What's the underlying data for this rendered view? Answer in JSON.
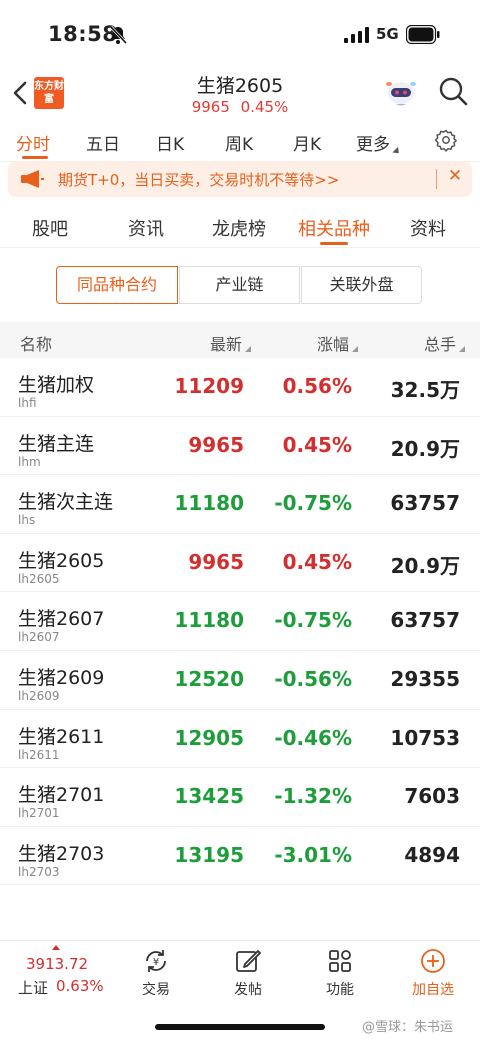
{
  "status": {
    "time": "18:58",
    "network": "5G"
  },
  "header": {
    "logo_text": "东方财富",
    "title": "生猪2605",
    "price": "9965",
    "change_pct": "0.45%"
  },
  "period_tabs": [
    {
      "label": "分时",
      "active": true
    },
    {
      "label": "五日"
    },
    {
      "label": "日K"
    },
    {
      "label": "周K"
    },
    {
      "label": "月K"
    },
    {
      "label": "更多"
    }
  ],
  "banner": {
    "text": "期货T+0，当日买卖，交易时机不等待>>",
    "close": "✕"
  },
  "main_tabs": [
    {
      "label": "股吧"
    },
    {
      "label": "资讯"
    },
    {
      "label": "龙虎榜"
    },
    {
      "label": "相关品种",
      "active": true
    },
    {
      "label": "资料"
    }
  ],
  "segments": [
    {
      "label": "同品种合约",
      "active": true
    },
    {
      "label": "产业链"
    },
    {
      "label": "关联外盘"
    }
  ],
  "table": {
    "headers": {
      "name": "名称",
      "latest": "最新",
      "change": "涨幅",
      "volume": "总手"
    },
    "rows": [
      {
        "name": "生猪加权",
        "code": "lhfi",
        "latest": "11209",
        "change": "0.56%",
        "volume": "32.5万",
        "trend": "up"
      },
      {
        "name": "生猪主连",
        "code": "lhm",
        "latest": "9965",
        "change": "0.45%",
        "volume": "20.9万",
        "trend": "up"
      },
      {
        "name": "生猪次主连",
        "code": "lhs",
        "latest": "11180",
        "change": "-0.75%",
        "volume": "63757",
        "trend": "down"
      },
      {
        "name": "生猪2605",
        "code": "lh2605",
        "latest": "9965",
        "change": "0.45%",
        "volume": "20.9万",
        "trend": "up"
      },
      {
        "name": "生猪2607",
        "code": "lh2607",
        "latest": "11180",
        "change": "-0.75%",
        "volume": "63757",
        "trend": "down"
      },
      {
        "name": "生猪2609",
        "code": "lh2609",
        "latest": "12520",
        "change": "-0.56%",
        "volume": "29355",
        "trend": "down"
      },
      {
        "name": "生猪2611",
        "code": "lh2611",
        "latest": "12905",
        "change": "-0.46%",
        "volume": "10753",
        "trend": "down"
      },
      {
        "name": "生猪2701",
        "code": "lh2701",
        "latest": "13425",
        "change": "-1.32%",
        "volume": "7603",
        "trend": "down"
      },
      {
        "name": "生猪2703",
        "code": "lh2703",
        "latest": "13195",
        "change": "-3.01%",
        "volume": "4894",
        "trend": "down"
      }
    ]
  },
  "bottom": {
    "index_value": "3913.72",
    "index_name": "上证",
    "index_pct": "0.63%",
    "nav": [
      {
        "label": "交易",
        "icon": "yuan-exchange-icon"
      },
      {
        "label": "发帖",
        "icon": "edit-icon"
      },
      {
        "label": "功能",
        "icon": "grid-icon"
      },
      {
        "label": "加自选",
        "icon": "plus-circle-icon"
      }
    ]
  },
  "watermark": "@雪球：朱书运",
  "colors": {
    "accent": "#e8601c",
    "up": "#d32f2f",
    "down": "#1e9e3a"
  }
}
